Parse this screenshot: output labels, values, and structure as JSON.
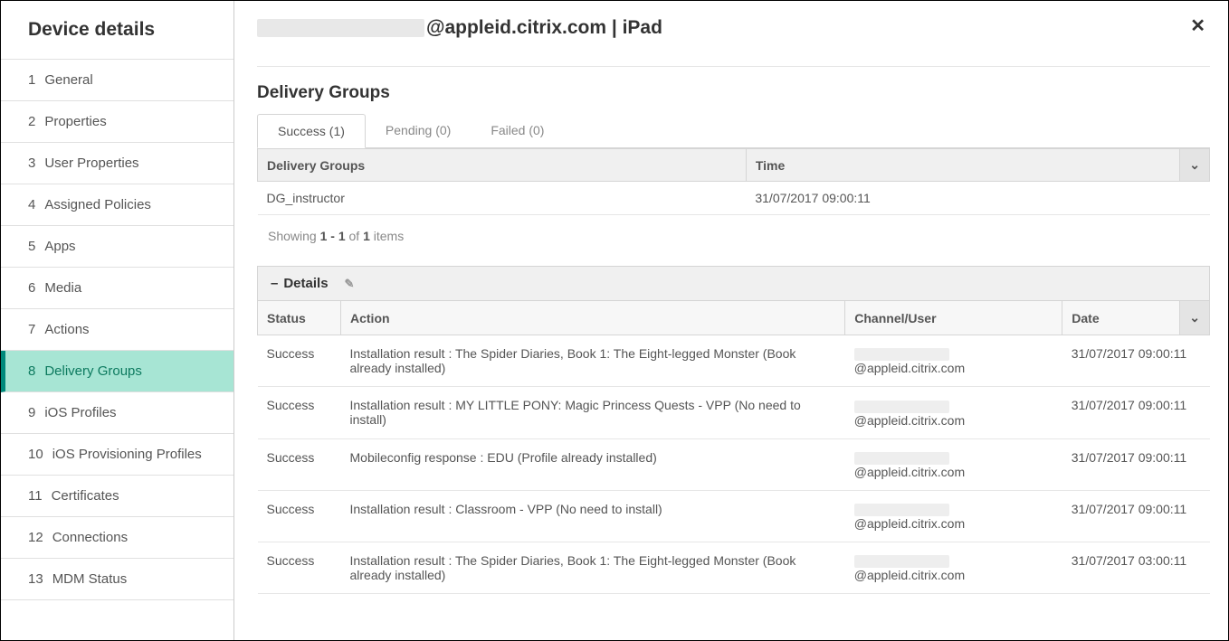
{
  "sidebar": {
    "title": "Device details",
    "items": [
      {
        "n": "1",
        "label": "General"
      },
      {
        "n": "2",
        "label": "Properties"
      },
      {
        "n": "3",
        "label": "User Properties"
      },
      {
        "n": "4",
        "label": "Assigned Policies"
      },
      {
        "n": "5",
        "label": "Apps"
      },
      {
        "n": "6",
        "label": "Media"
      },
      {
        "n": "7",
        "label": "Actions"
      },
      {
        "n": "8",
        "label": "Delivery Groups"
      },
      {
        "n": "9",
        "label": "iOS Profiles"
      },
      {
        "n": "10",
        "label": "iOS Provisioning Profiles"
      },
      {
        "n": "11",
        "label": "Certificates"
      },
      {
        "n": "12",
        "label": "Connections"
      },
      {
        "n": "13",
        "label": "MDM Status"
      }
    ],
    "activeIndex": 7
  },
  "header": {
    "title_suffix": "@appleid.citrix.com | iPad"
  },
  "section": {
    "title": "Delivery Groups",
    "tabs": [
      {
        "label": "Success (1)"
      },
      {
        "label": "Pending (0)"
      },
      {
        "label": "Failed (0)"
      }
    ],
    "activeTab": 0
  },
  "dg_table": {
    "headers": {
      "groups": "Delivery Groups",
      "time": "Time"
    },
    "rows": [
      {
        "name": "DG_instructor",
        "time": "31/07/2017 09:00:11"
      }
    ]
  },
  "pagination": {
    "prefix": "Showing ",
    "range": "1 - 1",
    "mid": " of ",
    "total": "1",
    "suffix": " items"
  },
  "details": {
    "title": "Details",
    "headers": {
      "status": "Status",
      "action": "Action",
      "channel": "Channel/User",
      "date": "Date"
    },
    "user_suffix": "@appleid.citrix.com",
    "rows": [
      {
        "status": "Success",
        "action": "Installation result : The Spider Diaries, Book 1: The Eight-legged Monster (Book already installed)",
        "date": "31/07/2017 09:00:11"
      },
      {
        "status": "Success",
        "action": "Installation result : MY LITTLE PONY: Magic Princess Quests - VPP (No need to install)",
        "date": "31/07/2017 09:00:11"
      },
      {
        "status": "Success",
        "action": "Mobileconfig response : EDU (Profile already installed)",
        "date": "31/07/2017 09:00:11"
      },
      {
        "status": "Success",
        "action": "Installation result : Classroom - VPP (No need to install)",
        "date": "31/07/2017 09:00:11"
      },
      {
        "status": "Success",
        "action": "Installation result : The Spider Diaries, Book 1: The Eight-legged Monster (Book already installed)",
        "date": "31/07/2017 03:00:11"
      }
    ]
  }
}
